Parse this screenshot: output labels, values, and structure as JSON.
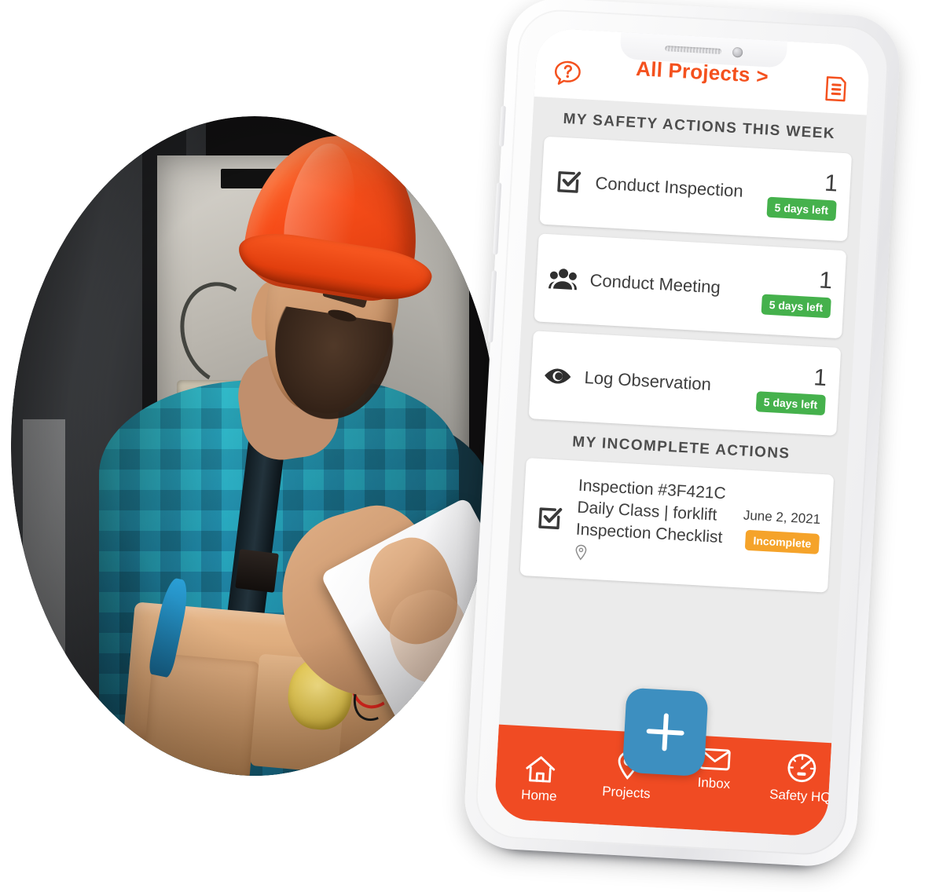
{
  "app": {
    "header": {
      "title": "All Projects",
      "chevron": ">",
      "help_icon": "help-question-bubble-icon",
      "menu_icon": "document-list-icon"
    },
    "sections": [
      {
        "title": "MY SAFETY ACTIONS THIS WEEK"
      },
      {
        "title": "MY INCOMPLETE ACTIONS"
      }
    ],
    "safety_actions": [
      {
        "icon": "checkbox-check-icon",
        "label": "Conduct Inspection",
        "count": "1",
        "badge": "5 days left"
      },
      {
        "icon": "people-group-icon",
        "label": "Conduct Meeting",
        "count": "1",
        "badge": "5 days left"
      },
      {
        "icon": "eye-icon",
        "label": "Log Observation",
        "count": "1",
        "badge": "5 days left"
      }
    ],
    "incomplete_actions": [
      {
        "icon": "checkbox-check-icon",
        "line1": "Inspection #3F421C",
        "line2": "Daily Class | forklift",
        "line3": "Inspection Checklist",
        "location_icon": "location-pin-icon",
        "date": "June 2, 2021",
        "status": "Incomplete"
      }
    ],
    "bottom_nav": {
      "items": [
        {
          "label": "Home",
          "icon": "home-icon"
        },
        {
          "label": "Projects",
          "icon": "location-pin-icon"
        },
        {
          "label": "Inbox",
          "icon": "envelope-icon"
        },
        {
          "label": "Safety HQ",
          "icon": "speedometer-gauge-icon"
        }
      ],
      "fab": {
        "icon": "plus-icon",
        "label": "+"
      }
    }
  },
  "photo": {
    "alt": "construction worker in orange hard hat using a tablet"
  },
  "colors": {
    "brand_orange": "#f04b23",
    "header_orange": "#f4511e",
    "badge_green": "#45b14c",
    "badge_orange": "#f5a32a",
    "fab_blue": "#3d8fc0",
    "screen_bg": "#ebebeb",
    "text_dark": "#3e3e3e"
  }
}
